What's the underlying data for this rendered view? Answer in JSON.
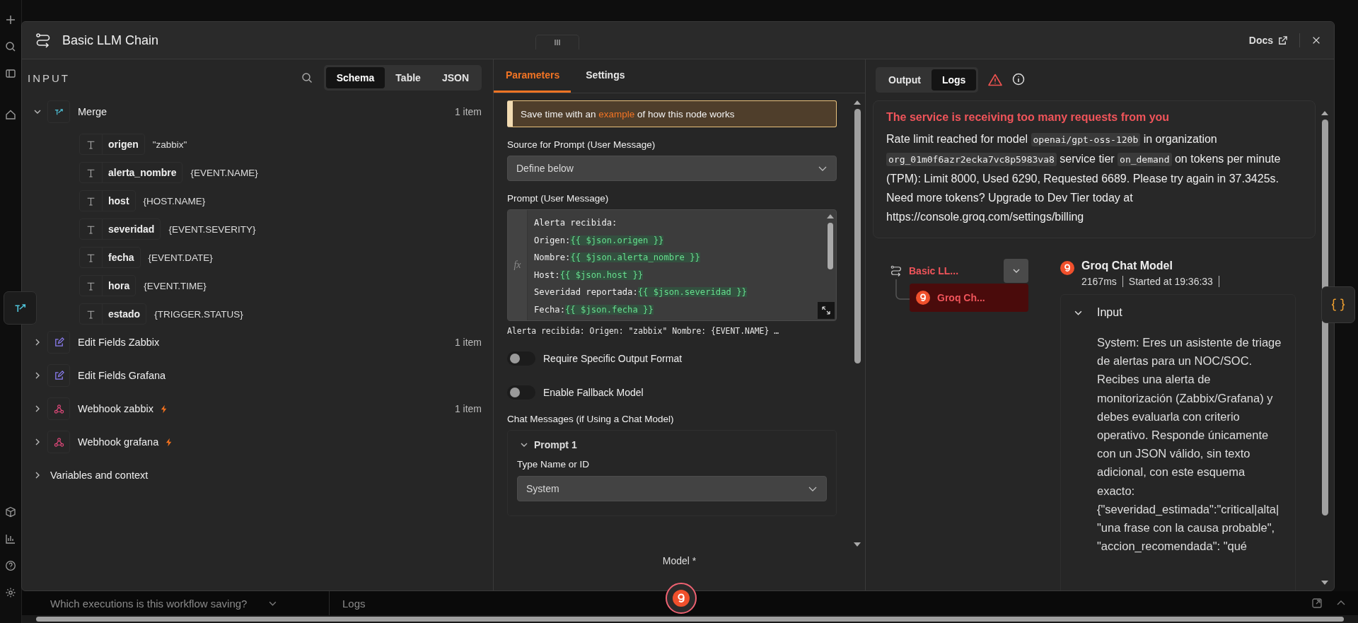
{
  "app": {
    "bottom_bar": {
      "executions_dropdown": "Which executions is this workflow saving?",
      "logs_label": "Logs"
    }
  },
  "modal": {
    "title": "Basic LLM Chain",
    "docs_link": "Docs"
  },
  "input_panel": {
    "heading": "INPUT",
    "view_tabs": [
      {
        "label": "Schema",
        "selected": true
      },
      {
        "label": "Table",
        "selected": false
      },
      {
        "label": "JSON",
        "selected": false
      }
    ],
    "tree": [
      {
        "name": "Merge",
        "kind": "merge",
        "expanded": true,
        "trigger": false,
        "count": "1 item",
        "fields": [
          {
            "key": "origen",
            "value": "\"zabbix\""
          },
          {
            "key": "alerta_nombre",
            "value": "{EVENT.NAME}"
          },
          {
            "key": "host",
            "value": "{HOST.NAME}"
          },
          {
            "key": "severidad",
            "value": "{EVENT.SEVERITY}"
          },
          {
            "key": "fecha",
            "value": "{EVENT.DATE}"
          },
          {
            "key": "hora",
            "value": "{EVENT.TIME}"
          },
          {
            "key": "estado",
            "value": "{TRIGGER.STATUS}"
          }
        ]
      },
      {
        "name": "Edit Fields Zabbix",
        "kind": "edit",
        "expanded": false,
        "trigger": false,
        "count": "1 item"
      },
      {
        "name": "Edit Fields Grafana",
        "kind": "edit",
        "expanded": false,
        "trigger": false
      },
      {
        "name": "Webhook zabbix",
        "kind": "webhook",
        "expanded": false,
        "trigger": true,
        "count": "1 item"
      },
      {
        "name": "Webhook grafana",
        "kind": "webhook",
        "expanded": false,
        "trigger": true
      }
    ],
    "variables": {
      "label": "Variables and context",
      "expanded": false
    }
  },
  "parameters_panel": {
    "tabs": [
      {
        "label": "Parameters",
        "selected": true
      },
      {
        "label": "Settings",
        "selected": false
      }
    ],
    "callout": {
      "before": "Save time with an",
      "link": "example",
      "after": "of how this node works"
    },
    "source_label": "Source for Prompt (User Message)",
    "source_value": "Define below",
    "prompt_label": "Prompt (User Message)",
    "expression_marker": "fx",
    "prompt_lines": [
      {
        "text": "Alerta recibida:"
      },
      {
        "text": "Origen:",
        "expr": "{{ $json.origen }}"
      },
      {
        "text": "Nombre:",
        "expr": "{{ $json.alerta_nombre }}"
      },
      {
        "text": "Host:",
        "expr": "{{ $json.host }}"
      },
      {
        "text": "Severidad reportada:",
        "expr": "{{ $json.severidad }}"
      },
      {
        "text": "Fecha:",
        "expr": "{{ $json.fecha }}"
      }
    ],
    "prompt_preview": "Alerta recibida: Origen: \"zabbix\" Nombre: {EVENT.NAME} …",
    "toggles": [
      {
        "label": "Require Specific Output Format",
        "on": false
      },
      {
        "label": "Enable Fallback Model",
        "on": false
      }
    ],
    "chat_messages_label": "Chat Messages (if Using a Chat Model)",
    "chat_prompt": {
      "title": "Prompt 1",
      "expanded": true,
      "type_label": "Type Name or ID",
      "type_value": "System"
    },
    "model_label": "Model *"
  },
  "output_panel": {
    "tabs": [
      {
        "label": "Output",
        "selected": false
      },
      {
        "label": "Logs",
        "selected": true
      }
    ],
    "error": {
      "title": "The service is receiving too many requests from you",
      "segments": [
        {
          "kind": "text",
          "text": "Rate limit reached for model "
        },
        {
          "kind": "code",
          "text": "openai/gpt-oss-120b"
        },
        {
          "kind": "text",
          "text": " in organization "
        },
        {
          "kind": "code",
          "text": "org_01m0f6azr2ecka7vc8p5983va8"
        },
        {
          "kind": "text",
          "text": " service tier "
        },
        {
          "kind": "code",
          "text": "on_demand"
        },
        {
          "kind": "text",
          "text": " on tokens per minute (TPM): Limit 8000, Used 6290, Requested 6689. Please try again in 37.3425s. Need more tokens? Upgrade to Dev Tier today at https://console.groq.com/settings/billing"
        }
      ]
    },
    "log_tree": [
      {
        "name": "Basic LL...",
        "kind": "chain",
        "error": true,
        "selected": false,
        "expanded": true,
        "children": [
          {
            "name": "Groq Ch...",
            "kind": "groq",
            "error": true,
            "selected": true
          }
        ]
      }
    ],
    "log_detail": {
      "title": "Groq Chat Model",
      "duration": "2167ms",
      "started": "Started at 19:36:33",
      "input_heading": "Input",
      "input_expanded": true,
      "input_text": "System: Eres un asistente de triage de alertas para un NOC/SOC. Recibes una alerta de monitorización (Zabbix/Grafana) y debes evaluarla con criterio operativo. Responde únicamente con un JSON válido, sin texto adicional, con este esquema exacto:\n{\"severidad_estimada\":\"critical|alta|\n\"una frase con la causa probable\",\n\"accion_recomendada\": \"qué"
    }
  }
}
